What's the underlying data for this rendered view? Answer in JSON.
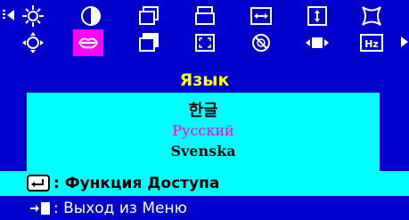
{
  "menu": {
    "title": "Язык",
    "icons_row1": [
      "brightness-icon",
      "contrast-icon",
      "position-icon",
      "size-icon",
      "h-size-icon",
      "v-size-icon",
      "pincushion-icon"
    ],
    "icons_row2": [
      "image-position-icon",
      "language-icon",
      "recall-icon",
      "zoom-icon",
      "degauss-icon",
      "moire-icon",
      "frequency-icon"
    ],
    "selected_icon": "language-icon",
    "frequency_label": "Hz"
  },
  "languages": {
    "items": [
      "한글",
      "Русский",
      "Svenska"
    ],
    "selected": "Русский"
  },
  "footer": {
    "access_label": ": Функция Доступа",
    "exit_label": ": Выход из Меню"
  },
  "colors": {
    "background": "#0000cc",
    "panel": "#00ffff",
    "title": "#ffff00",
    "selected": "#ff00ff"
  }
}
